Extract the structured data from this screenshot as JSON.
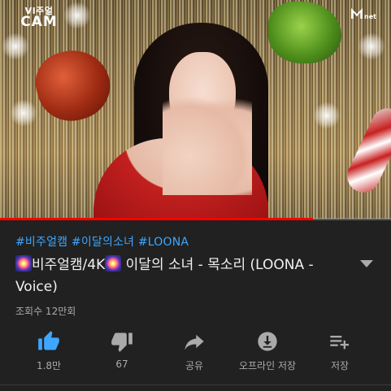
{
  "video": {
    "channel_logo": {
      "line1": "VI주얼",
      "line2": "CAM",
      "line3": ""
    },
    "broadcaster_logo": {
      "mark": "M",
      "suffix": "net"
    },
    "progress_percent": 80
  },
  "hashtags": "#비주얼캠 #이달의소녀 #LOONA",
  "title": {
    "part1": "비주얼캠/4K",
    "part2": " 이달의 소녀 - 목소리 (LOONA - Voice)",
    "emoji_name": "fireworks-emoji"
  },
  "views": "조회수 12만회",
  "actions": [
    {
      "name": "like-button",
      "icon": "thumbs-up-icon",
      "label": "1.8만",
      "color": "#3ea6ff"
    },
    {
      "name": "dislike-button",
      "icon": "thumbs-down-icon",
      "label": "67",
      "color": "#aaaaaa"
    },
    {
      "name": "share-button",
      "icon": "share-icon",
      "label": "공유",
      "color": "#aaaaaa"
    },
    {
      "name": "offline-save-button",
      "icon": "download-icon",
      "label": "오프라인 저장",
      "color": "#aaaaaa"
    },
    {
      "name": "save-to-playlist-button",
      "icon": "playlist-add-icon",
      "label": "저장",
      "color": "#aaaaaa"
    }
  ],
  "colors": {
    "background": "#212121",
    "hashtag": "#3ea6ff",
    "progress": "#ff0000",
    "secondary_text": "#aaaaaa"
  }
}
